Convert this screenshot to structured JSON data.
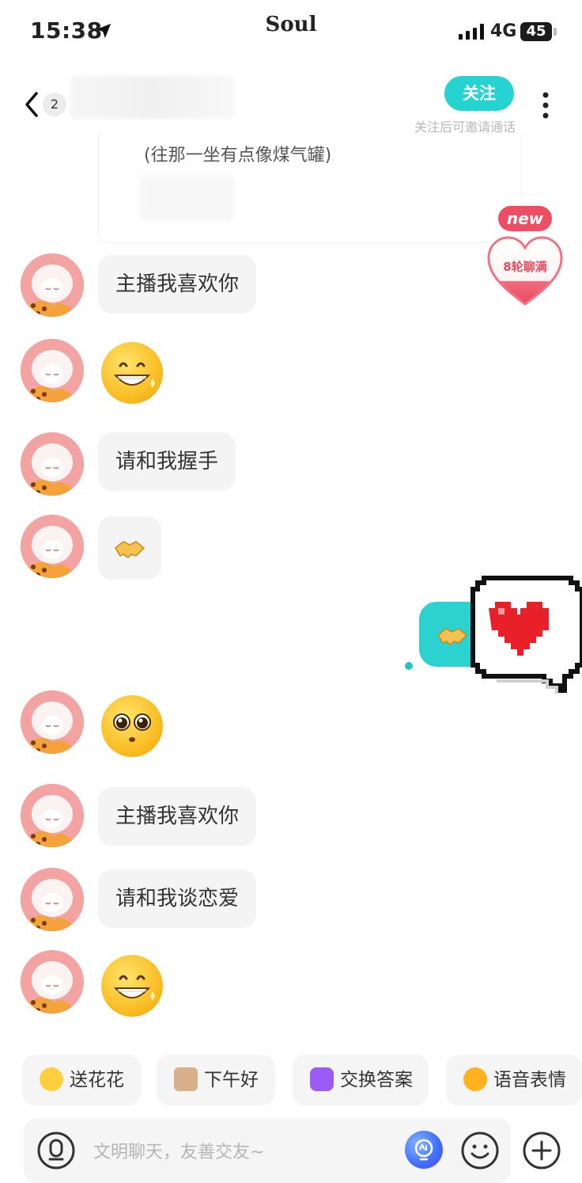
{
  "status_bar": {
    "time": "15:38",
    "app_name": "Soul",
    "network": "4G",
    "battery": "45"
  },
  "header": {
    "unread_count": "2",
    "follow_label": "关注",
    "follow_hint": "关注后可邀请通话"
  },
  "quote": {
    "text": "(往那一坐有点像煤气罐)"
  },
  "badge": {
    "new_label": "new",
    "rounds_label": "8轮聊满"
  },
  "messages": [
    {
      "type": "text",
      "text": "主播我喜欢你"
    },
    {
      "type": "emoji",
      "icon": "grinning-face-icon"
    },
    {
      "type": "text",
      "text": "请和我握手"
    },
    {
      "type": "emoji-small",
      "icon": "handshake-icon"
    },
    {
      "type": "self-emoji",
      "icon": "handshake-icon"
    },
    {
      "type": "emoji",
      "icon": "pleading-face-icon"
    },
    {
      "type": "text",
      "text": "主播我喜欢你"
    },
    {
      "type": "text",
      "text": "请和我谈恋爱"
    },
    {
      "type": "emoji",
      "icon": "grinning-face-icon"
    }
  ],
  "quick_replies": [
    {
      "label": "送花花",
      "icon": "flower-face-icon",
      "color": "#ffcf3f"
    },
    {
      "label": "下午好",
      "icon": "coffee-icon",
      "color": "#d9b08c"
    },
    {
      "label": "交换答案",
      "icon": "swap-icon",
      "color": "#9b5cf6"
    },
    {
      "label": "语音表情",
      "icon": "voice-emoji-icon",
      "color": "#ffb21f"
    }
  ],
  "input": {
    "placeholder": "文明聊天，友善交友~"
  },
  "colors": {
    "accent": "#25d4d0",
    "badge": "#ee4e63"
  }
}
